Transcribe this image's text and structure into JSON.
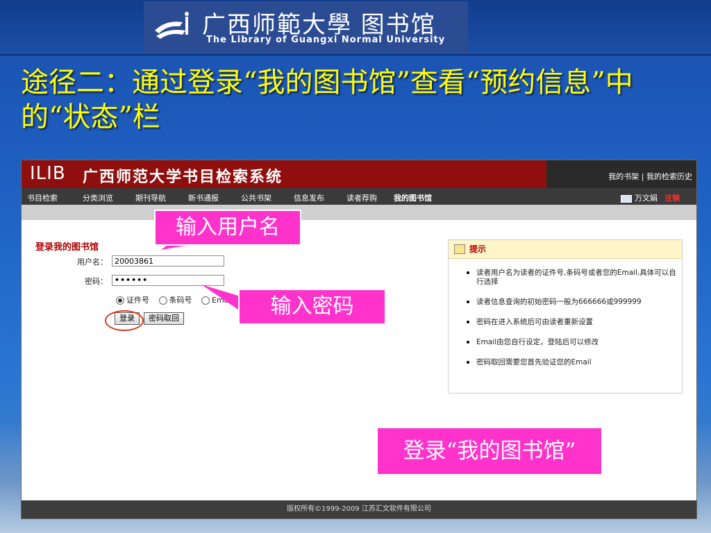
{
  "header": {
    "logo_cn": "广西师範大學 图书馆",
    "logo_en": "The Library of Guangxi Normal University"
  },
  "slide": {
    "title": "途径二：通过登录“我的图书馆”查看“预约信息”中的“状态”栏"
  },
  "browser": {
    "logo": "ILIB",
    "system_title": "广西师范大学书目检索系统",
    "top_links": "我的书架 | 我的检索历史",
    "nav": [
      "书目检索",
      "分类浏览",
      "期刊导航",
      "新书通报",
      "公共书架",
      "信息发布",
      "读者荐购",
      "我的图书馆"
    ],
    "user_name": "万文娟",
    "logout_label": "注销",
    "login": {
      "title": "登录我的图书馆",
      "username_label": "用户名：",
      "username_value": "20003861",
      "password_label": "密码：",
      "password_value": "••••••",
      "radio_options": [
        "证件号",
        "条码号",
        "Email"
      ],
      "selected_option": "证件号",
      "login_button": "登录",
      "retrieve_button": "密码取回"
    },
    "tips": {
      "title": "提示",
      "items": [
        "读者用户名为读者的证件号,条码号或者您的Email,具体可以自行选择",
        "读者信息查询的初始密码一般为666666或999999",
        "密码在进入系统后可由读者重新设置",
        "Email由您自行设定，登陆后可以修改",
        "密码取回需要您首先验证您的Email"
      ]
    },
    "footer": "版权所有©1999-2009 江苏汇文软件有限公司"
  },
  "callouts": {
    "username": "输入用户名",
    "password": "输入密码",
    "login": "登录“我的图书馆”"
  },
  "colors": {
    "accent_title": "#ffff00",
    "callout": "#ff33cc",
    "ilib_header": "#8f0f0f"
  }
}
